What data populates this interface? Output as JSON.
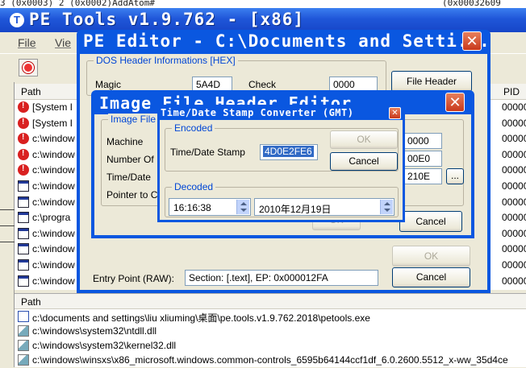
{
  "main": {
    "top_strip": "3 (0x0003)    2 (0x0002)AddAtom#",
    "top_strip_right": "(0x00032609",
    "title": "PE Tools v1.9.762 - [x86]",
    "menu": [
      "File",
      "Vie"
    ],
    "process_columns": {
      "path": "Path",
      "pid": "PID"
    },
    "processes": [
      {
        "icon": "error-icon",
        "path": "[System I",
        "pid": "00000"
      },
      {
        "icon": "error-icon",
        "path": "[System I",
        "pid": "00000"
      },
      {
        "icon": "error-icon",
        "path": "c:\\window",
        "pid": "00000"
      },
      {
        "icon": "error-icon",
        "path": "c:\\window",
        "pid": "00000"
      },
      {
        "icon": "error-icon",
        "path": "c:\\window",
        "pid": "00000"
      },
      {
        "icon": "window-icon",
        "path": "c:\\window",
        "pid": "00000"
      },
      {
        "icon": "window-icon",
        "path": "c:\\window",
        "pid": "00000"
      },
      {
        "icon": "window-icon",
        "path": "c:\\progra",
        "pid": "00000"
      },
      {
        "icon": "window-icon",
        "path": "c:\\window",
        "pid": "00000"
      },
      {
        "icon": "window-icon",
        "path": "c:\\window",
        "pid": "00000"
      },
      {
        "icon": "window-icon",
        "path": "c:\\window",
        "pid": "00000"
      },
      {
        "icon": "window-icon",
        "path": "c:\\window",
        "pid": "00000"
      }
    ],
    "module_column": "Path",
    "modules": [
      {
        "icon": "exe-icon",
        "path": "c:\\documents and settings\\liu xliuming\\桌面\\pe.tools.v1.9.762.2018\\petools.exe"
      },
      {
        "icon": "dll-icon",
        "path": "c:\\windows\\system32\\ntdll.dll"
      },
      {
        "icon": "dll-icon",
        "path": "c:\\windows\\system32\\kernel32.dll"
      },
      {
        "icon": "dll-icon",
        "path": "c:\\windows\\winsxs\\x86_microsoft.windows.common-controls_6595b64144ccf1df_6.0.2600.5512_x-ww_35d4ce"
      }
    ]
  },
  "pe_editor": {
    "title": "PE Editor - C:\\Documents and Setti...",
    "dos_group": "DOS Header Informations [HEX]",
    "dos_field1_label": "Magic",
    "dos_field1_value": "5A4D",
    "dos_field2_label": "Check",
    "dos_field2_value": "0000",
    "file_header_button": "File Header",
    "ok_button": "OK",
    "cancel_button": "Cancel",
    "entry_point_label": "Entry Point (RAW):",
    "entry_point_value": "Section: [.text], EP: 0x000012FA"
  },
  "image_file_header_editor": {
    "title": "Image File Header Editor",
    "group": "Image File H",
    "labels": [
      "Machine",
      "Number Of",
      "Time/Date",
      "Pointer to C"
    ],
    "values": [
      "0000",
      "00E0",
      "210E"
    ],
    "browse_button": "...",
    "ok_button": "OK",
    "cancel_button": "Cancel"
  },
  "tds_converter": {
    "title": "Time/Date Stamp Converter (GMT)",
    "encoded_group": "Encoded",
    "stamp_label": "Time/Date Stamp",
    "stamp_value": "4D0E2FE6",
    "ok_button": "OK",
    "cancel_button": "Cancel",
    "decoded_group": "Decoded",
    "time_value": "16:16:38",
    "date_value": "2010年12月19日"
  },
  "colors": {
    "titlebar": "#0a57e0",
    "close": "#d9502e",
    "groupbox_label": "#0046d5"
  }
}
